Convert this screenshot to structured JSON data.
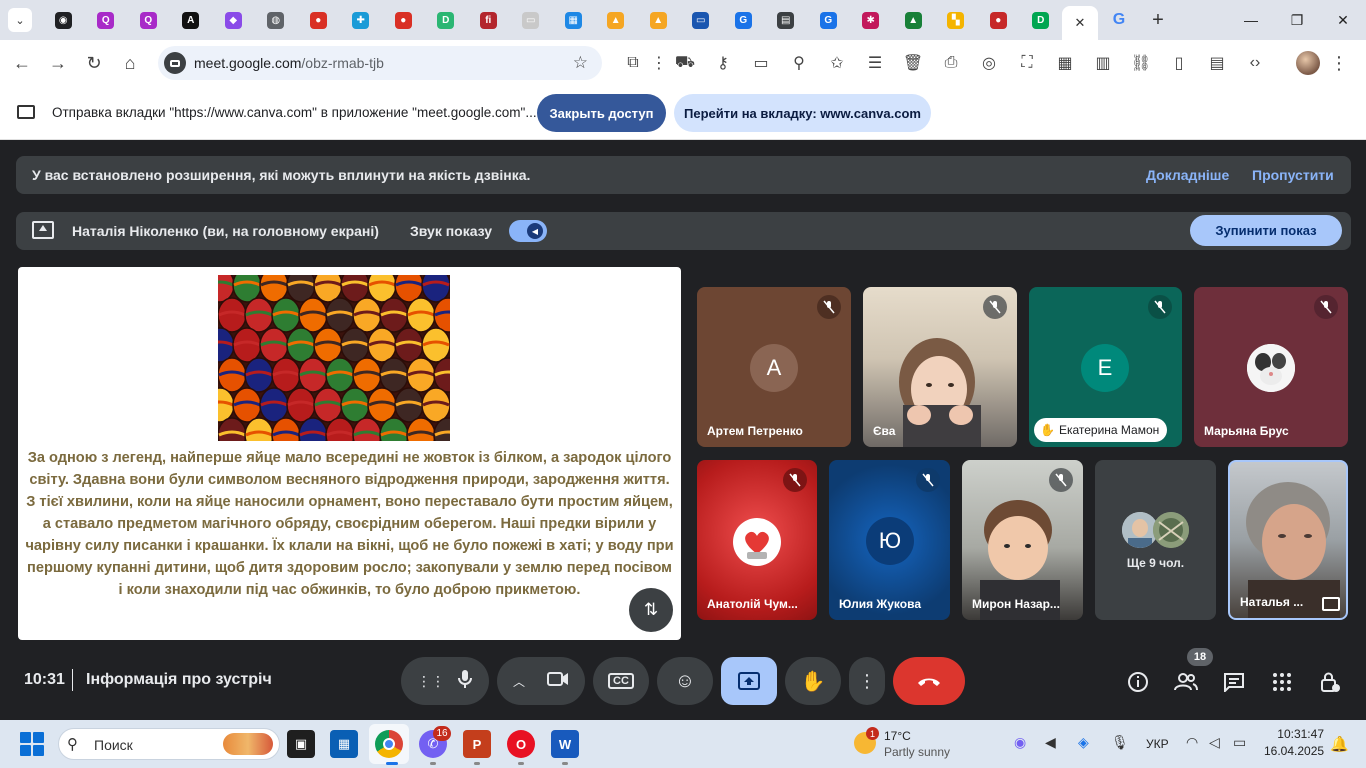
{
  "browser": {
    "url_host": "meet.google.com",
    "url_path": "/obz-rmab-tjb",
    "tab_close": "✕",
    "favicons": [
      {
        "icon": "media-icon",
        "color": "#202124",
        "glyph": "◉"
      },
      {
        "icon": "quora-icon",
        "color": "#a82ac8",
        "glyph": "Q"
      },
      {
        "icon": "quora-icon",
        "color": "#a82ac8",
        "glyph": "Q"
      },
      {
        "icon": "adobe-icon",
        "color": "#111111",
        "glyph": "A"
      },
      {
        "icon": "cube-icon",
        "color": "#8a4be8",
        "glyph": "◆"
      },
      {
        "icon": "globe-icon",
        "color": "#5f6368",
        "glyph": "◍"
      },
      {
        "icon": "red-ball-icon",
        "color": "#d93025",
        "glyph": "●"
      },
      {
        "icon": "puzzle-icon",
        "color": "#1a9bd7",
        "glyph": "✚"
      },
      {
        "icon": "red-ball-icon",
        "color": "#d93025",
        "glyph": "●"
      },
      {
        "icon": "d-icon",
        "color": "#2bb673",
        "glyph": "D"
      },
      {
        "icon": "fi-icon",
        "color": "#b3262d",
        "glyph": "fi"
      },
      {
        "icon": "slides-icon",
        "color": "#c9c9c9",
        "glyph": "▭"
      },
      {
        "icon": "grid-icon",
        "color": "#1e88e5",
        "glyph": "▦"
      },
      {
        "icon": "bell-icon",
        "color": "#f5a623",
        "glyph": "▲"
      },
      {
        "icon": "bell-icon",
        "color": "#f5a623",
        "glyph": "▲"
      },
      {
        "icon": "monitor-icon",
        "color": "#1a56b0",
        "glyph": "▭"
      },
      {
        "icon": "g-icon",
        "color": "#1a73e8",
        "glyph": "G"
      },
      {
        "icon": "calendar-icon",
        "color": "#3c4043",
        "glyph": "▤"
      },
      {
        "icon": "g-icon",
        "color": "#1a73e8",
        "glyph": "G"
      },
      {
        "icon": "pattern-icon",
        "color": "#c2185b",
        "glyph": "✱"
      },
      {
        "icon": "drive-icon",
        "color": "#188038",
        "glyph": "▲"
      },
      {
        "icon": "blocks-icon",
        "color": "#f4b400",
        "glyph": "▚"
      },
      {
        "icon": "red-app-icon",
        "color": "#c62828",
        "glyph": "●"
      },
      {
        "icon": "d-icon",
        "color": "#00a651",
        "glyph": "D"
      }
    ],
    "active_tab_close": "✕",
    "new_tab": "+"
  },
  "infobar": {
    "message": "Отправка вкладки \"https://www.canva.com\" в приложение \"meet.google.com\"...",
    "stop_access": "Закрыть доступ",
    "go_to_tab": "Перейти на вкладку: www.canva.com"
  },
  "meet": {
    "extension_warning": "У вас встановлено розширення, які можуть вплинути на якість дзвінка.",
    "learn_more": "Докладніше",
    "skip": "Пропустити",
    "presenter": "Наталія Ніколенко (ви, на головному екрані)",
    "share_sound": "Звук показу",
    "stop_sharing": "Зупинити показ",
    "shared_text": "За одною з легенд, найперше яйце мало всередині не жовток із білком, а зародок цілого світу. Здавна вони були символом весняного відродження природи, зародження життя. З тієї хвилини, коли на яйце наносили орнамент, воно переставало бути простим яйцем, а ставало предметом магічного обряду, своєрідним оберегом. Наші предки вірили у чарівну силу писанки і крашанки. Їх клали на вікні, щоб не було пожежі в хаті; у воду при першому купанні дитини, щоб дитя здоровим росло; закопували у землю перед посівом і коли знаходили під час обжинків, то було доброю прикметою.",
    "participants": [
      {
        "name": "Артем Петренко",
        "initial": "A"
      },
      {
        "name": "Єва"
      },
      {
        "name": "Екатерина Мамон",
        "initial": "E"
      },
      {
        "name": "Марьяна Брус"
      },
      {
        "name": "Анатолій Чум..."
      },
      {
        "name": "Юлия Жукова",
        "initial": "Ю"
      },
      {
        "name": "Мирон Назар..."
      },
      {
        "name": "Ще 9 чол."
      },
      {
        "name": "Наталья ..."
      }
    ],
    "clock": "10:31",
    "meeting_info": "Інформація про зустріч",
    "people_count": "18"
  },
  "taskbar": {
    "search_placeholder": "Поиск",
    "viber_badge": "16",
    "weather_badge": "1",
    "temperature": "17°C",
    "condition": "Partly sunny",
    "language": "УКР",
    "time": "10:31:47",
    "date": "16.04.2025"
  }
}
